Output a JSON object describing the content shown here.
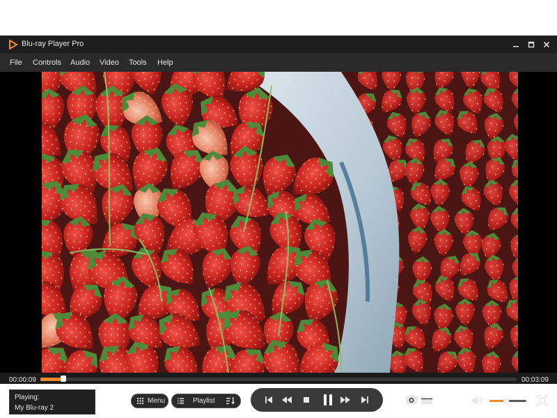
{
  "app": {
    "title": "Blu-ray Player Pro",
    "accent": "#f08b2a"
  },
  "window_controls": [
    "minimize-icon",
    "maximize-icon",
    "close-icon"
  ],
  "menu": [
    "File",
    "Controls",
    "Audio",
    "Video",
    "Tools",
    "Help"
  ],
  "video": {
    "subject": "strawberries"
  },
  "playback": {
    "current_time": "00:00:09",
    "total_time": "00:03:09",
    "progress_percent": 4.8
  },
  "now_playing": {
    "label": "Playing:",
    "title": "My Blu-ray 2"
  },
  "buttons": {
    "menu_label": "Menu",
    "playlist_label": "Playlist"
  },
  "transport": [
    "previous-icon",
    "rewind-icon",
    "stop-icon",
    "pause-icon",
    "fast-forward-icon",
    "next-icon"
  ],
  "tools": [
    "snapshot-icon",
    "open-folder-icon"
  ],
  "volume": {
    "percent": 45
  },
  "fullscreen_icon": "fullscreen-icon"
}
